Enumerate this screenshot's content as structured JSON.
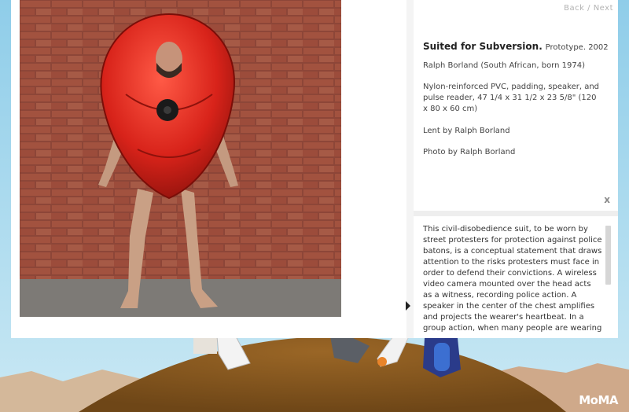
{
  "nav": {
    "back": "Back",
    "separator": "/",
    "next": "Next"
  },
  "artwork": {
    "title": "Suited for Subversion.",
    "subtitle": "Prototype. 2002",
    "artist": "Ralph Borland (South African, born 1974)",
    "medium": "Nylon-reinforced PVC, padding, speaker, and pulse reader, 47 1/4 x 31 1/2 x 23 5/8\" (120 x 80 x 60 cm)",
    "credit": "Lent by Ralph Borland",
    "photo_credit": "Photo by Ralph Borland"
  },
  "close_label": "x",
  "description": "This civil-disobedience suit, to be worn by street protesters for protection against police batons, is a conceptual statement that draws attention to the risks protesters must face in order to defend their convictions. A wireless video camera mounted over the head acts as a witness, recording police action. A speaker in the center of the chest amplifies and projects the wearer's heartbeat. In a group action, when many people are wearing",
  "brand": "MoMA",
  "colors": {
    "suit_red": "#d8231a",
    "brick": "#9a4a3a",
    "ground": "#8a5a22"
  }
}
